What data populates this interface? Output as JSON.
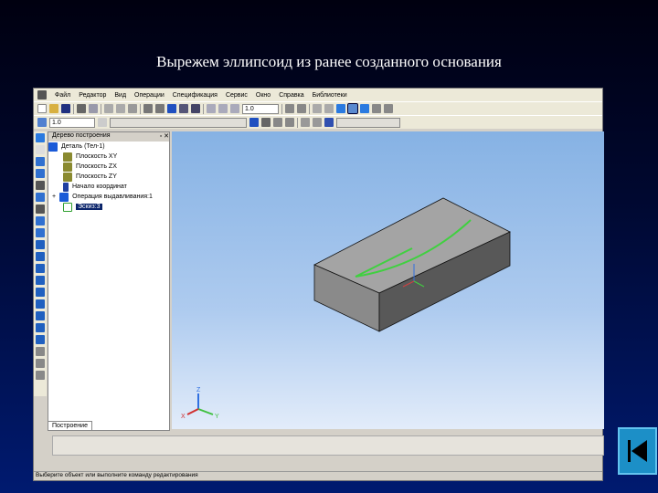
{
  "slide_title": "Вырежем эллипсоид из ранее созданного основания",
  "menu": [
    "Файл",
    "Редактор",
    "Вид",
    "Операции",
    "Спецификация",
    "Сервис",
    "Окно",
    "Справка",
    "Библиотеки"
  ],
  "toolbar": {
    "scale": "1.0",
    "line_style": "1.0"
  },
  "tree": {
    "header": "Дерево построения",
    "items": [
      {
        "label": "Деталь (Тел-1)",
        "color": "#1a5ad8"
      },
      {
        "label": "Плоскость XY",
        "color": "#8a8a30"
      },
      {
        "label": "Плоскость ZX",
        "color": "#8a8a30"
      },
      {
        "label": "Плоскость ZY",
        "color": "#8a8a30"
      },
      {
        "label": "Начало координат",
        "color": "#2040a0"
      },
      {
        "label": "Операция выдавливания:1",
        "color": "#1a5ad8"
      },
      {
        "label": "Эскиз:3",
        "color": "#30a030",
        "selected": true
      }
    ],
    "tab": "Построение"
  },
  "axes": {
    "x": "X",
    "y": "Y",
    "z": "Z"
  },
  "status": "Выберите объект или выполните команду редактирования"
}
